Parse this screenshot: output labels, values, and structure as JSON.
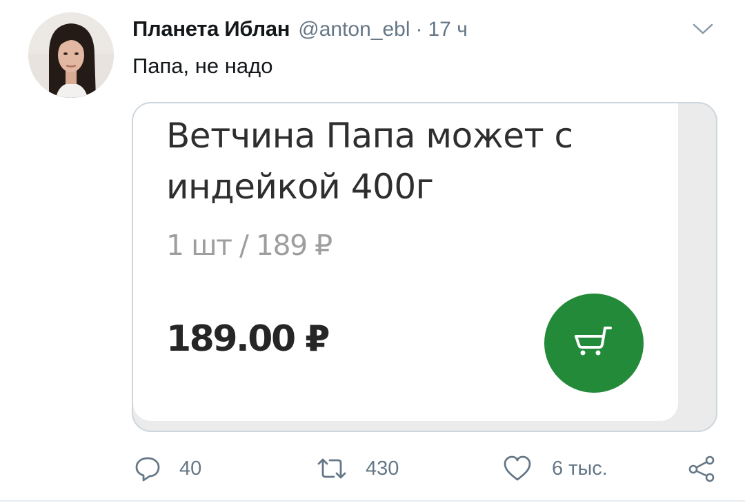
{
  "tweet": {
    "author_name": "Планета Иблан",
    "author_handle": "@anton_ebl",
    "separator": "·",
    "time": "17 ч",
    "text": "Папа, не надо"
  },
  "media": {
    "product_title": "Ветчина Папа может с индейкой 400г",
    "unit_price": "1 шт / 189 ₽",
    "price": "189.00 ₽",
    "cart_icon": "cart-icon",
    "accent_color": "#238a3a"
  },
  "actions": {
    "reply_count": "40",
    "retweet_count": "430",
    "like_count": "6 тыс.",
    "icons": [
      "reply-icon",
      "retweet-icon",
      "heart-icon",
      "share-icon"
    ]
  },
  "colors": {
    "text_primary": "#14171a",
    "text_secondary": "#657786",
    "border": "#ccd6dd"
  }
}
